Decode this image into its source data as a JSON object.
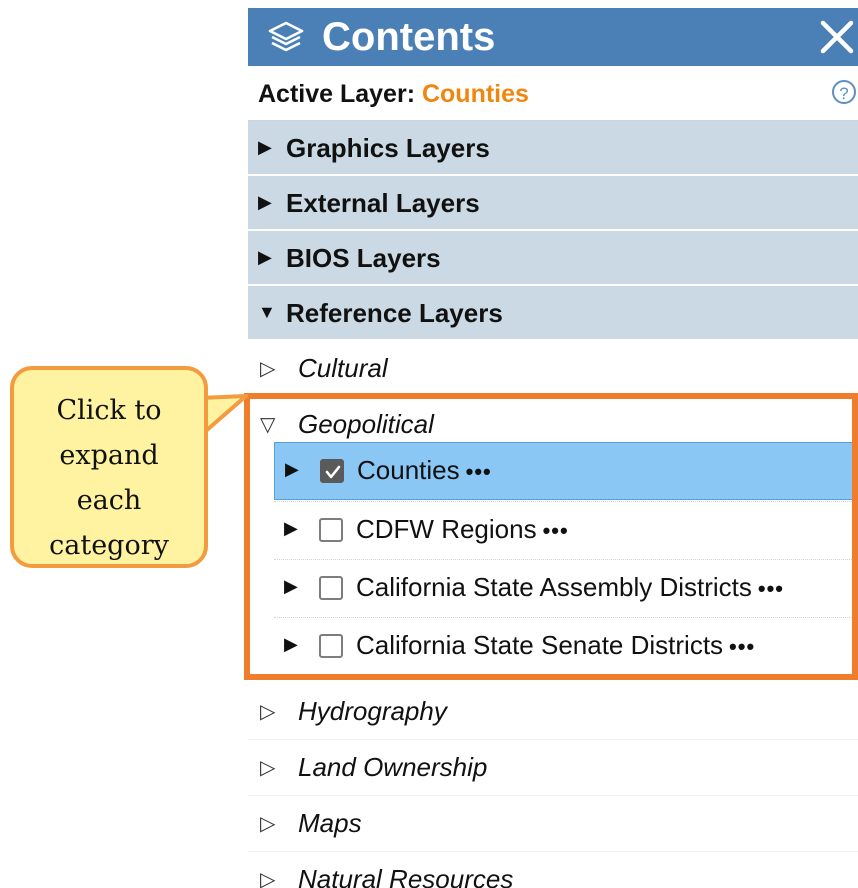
{
  "panel": {
    "title": "Contents",
    "header_icon": "layers-icon",
    "close_icon": "close-icon",
    "colors": {
      "header_bg": "#4a80b5",
      "section_bg": "#cad9e3",
      "selected_bg": "#8ac7f5",
      "active_value": "#f0860f",
      "highlight_border": "#f07d2c"
    }
  },
  "active_layer": {
    "label": "Active Layer:",
    "value": "Counties",
    "help_glyph": "?"
  },
  "sections": [
    {
      "arrow": "▶",
      "label": "Graphics Layers",
      "expanded": false
    },
    {
      "arrow": "▶",
      "label": "External Layers",
      "expanded": false
    },
    {
      "arrow": "▶",
      "label": "BIOS Layers",
      "expanded": false
    },
    {
      "arrow": "▼",
      "label": "Reference Layers",
      "expanded": true
    }
  ],
  "categories": [
    {
      "arrow": "▷",
      "label": "Cultural"
    },
    {
      "arrow": "▽",
      "label": "Geopolitical"
    },
    {
      "arrow": "▷",
      "label": "Hydrography"
    },
    {
      "arrow": "▷",
      "label": "Land Ownership"
    },
    {
      "arrow": "▷",
      "label": "Maps"
    },
    {
      "arrow": "▷",
      "label": "Natural Resources"
    }
  ],
  "geopolitical_layers": [
    {
      "arrow": "▶",
      "label": "Counties",
      "checked": true,
      "selected": true,
      "menu": "•••"
    },
    {
      "arrow": "▶",
      "label": "CDFW Regions",
      "checked": false,
      "selected": false,
      "menu": "•••"
    },
    {
      "arrow": "▶",
      "label": "California State Assembly Districts",
      "checked": false,
      "selected": false,
      "menu": "•••"
    },
    {
      "arrow": "▶",
      "label": "California State Senate Districts",
      "checked": false,
      "selected": false,
      "menu": "•••"
    }
  ],
  "callout": {
    "lines": [
      "Click to",
      "expand",
      "each",
      "category"
    ]
  }
}
